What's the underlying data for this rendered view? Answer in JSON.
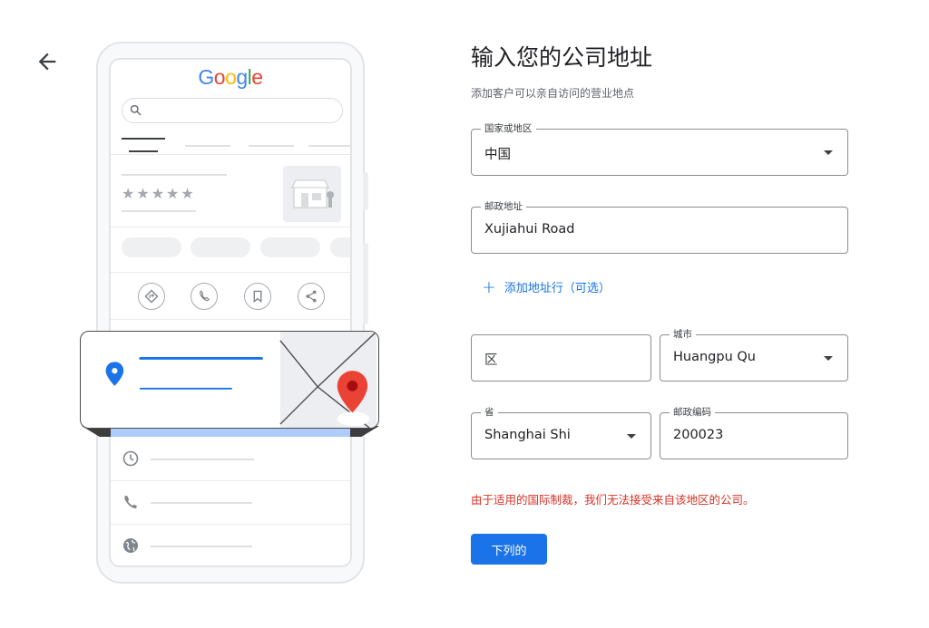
{
  "illustration": {
    "logo": {
      "G": "G",
      "o1": "o",
      "o2": "o",
      "g": "g",
      "l": "l",
      "e": "e"
    },
    "rating_stars": "★★★★★",
    "brand_colors": {
      "blue": "#4285f4",
      "red": "#ea4335",
      "yellow": "#fbbc05",
      "green": "#34a853"
    }
  },
  "header": {
    "title": "输入您的公司地址",
    "subtitle": "添加客户可以亲自访问的营业地点"
  },
  "form": {
    "country": {
      "label": "国家或地区",
      "value": "中国"
    },
    "street": {
      "label": "邮政地址",
      "value": "Xujiahui Road"
    },
    "add_address_line": {
      "icon": "+",
      "label": "添加地址行（可选）"
    },
    "district": {
      "placeholder": "区"
    },
    "city": {
      "label": "城市",
      "value": "Huangpu Qu"
    },
    "province": {
      "label": "省",
      "value": "Shanghai Shi"
    },
    "postal_code": {
      "label": "邮政编码",
      "value": "200023"
    },
    "error_message": "由于适用的国际制裁，我们无法接受来自该地区的公司。",
    "next_button": "下列的"
  },
  "colors": {
    "accent": "#1a73e8",
    "error": "#d93025",
    "border": "#8a8d91"
  }
}
